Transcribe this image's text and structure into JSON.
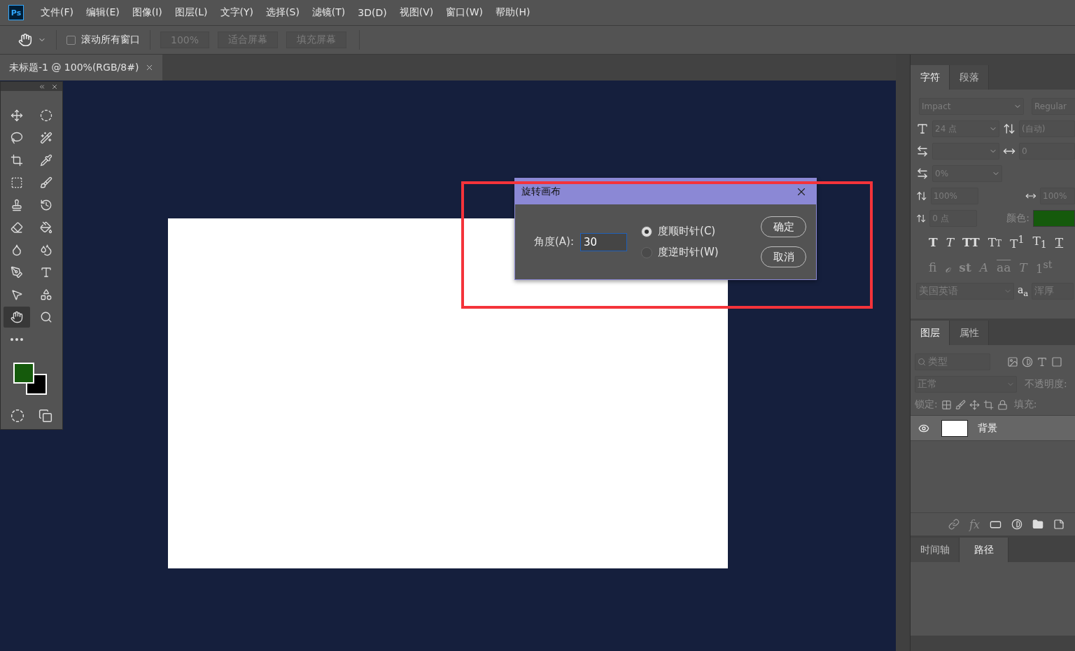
{
  "app_logo": "Ps",
  "menu": [
    "文件(F)",
    "编辑(E)",
    "图像(I)",
    "图层(L)",
    "文字(Y)",
    "选择(S)",
    "滤镜(T)",
    "3D(D)",
    "视图(V)",
    "窗口(W)",
    "帮助(H)"
  ],
  "options_bar": {
    "scroll_all": {
      "label": "滚动所有窗口",
      "checked": false
    },
    "buttons": [
      "100%",
      "适合屏幕",
      "填充屏幕"
    ]
  },
  "document_tab": {
    "title": "未标题-1 @ 100%(RGB/8#)"
  },
  "toolbox": {
    "tools": [
      {
        "kind": "move",
        "selected": false
      },
      {
        "kind": "marquee",
        "selected": false
      },
      {
        "kind": "lasso",
        "selected": false
      },
      {
        "kind": "wand",
        "selected": false
      },
      {
        "kind": "crop",
        "selected": false
      },
      {
        "kind": "eyedropper",
        "selected": false
      },
      {
        "kind": "frame",
        "selected": false
      },
      {
        "kind": "brush",
        "selected": false
      },
      {
        "kind": "stamp",
        "selected": false
      },
      {
        "kind": "history",
        "selected": false
      },
      {
        "kind": "eraser",
        "selected": false
      },
      {
        "kind": "bucket",
        "selected": false
      },
      {
        "kind": "smudge",
        "selected": false
      },
      {
        "kind": "dodge",
        "selected": false
      },
      {
        "kind": "pen",
        "selected": false
      },
      {
        "kind": "type",
        "selected": false
      },
      {
        "kind": "select",
        "selected": false
      },
      {
        "kind": "shape",
        "selected": false
      },
      {
        "kind": "hand",
        "selected": true
      },
      {
        "kind": "zoom",
        "selected": false
      },
      {
        "kind": "more",
        "selected": false
      }
    ],
    "swatches": [
      {
        "kind": "foreground",
        "color": "#155a0c"
      },
      {
        "kind": "background",
        "color": "#000000"
      }
    ]
  },
  "dialog": {
    "title": "旋转画布",
    "angle_label": "角度(A):",
    "angle_value": "30",
    "options": [
      {
        "label": "度顺时针(C)",
        "selected": true
      },
      {
        "label": "度逆时针(W)",
        "selected": false
      }
    ],
    "buttons": [
      "确定",
      "取消"
    ]
  },
  "character_panel": {
    "tabs": [
      {
        "label": "字符",
        "selected": true
      },
      {
        "label": "段落",
        "selected": false
      }
    ],
    "font_family": "Impact",
    "font_style": "Regular",
    "size": "24 点",
    "leading": "(自动)",
    "tracking": "0",
    "tsume": "0%",
    "vertical_scale": "100%",
    "horizontal_scale": "100%",
    "baseline_shift": "0 点",
    "color_label": "颜色:",
    "color": "#155a0c",
    "style_buttons": [
      {
        "text": "T",
        "kind": "bold"
      },
      {
        "text": "T",
        "kind": "italic"
      },
      {
        "text": "TT",
        "kind": "caps"
      },
      {
        "text": "Tт",
        "kind": "smallcaps"
      },
      {
        "text": "T$^{1}$",
        "kind": "plain"
      },
      {
        "text": "T$_{1}$",
        "kind": "plain"
      },
      {
        "text": "T",
        "kind": "underline"
      }
    ],
    "opentype_buttons": [
      {
        "text": "fi",
        "kind": "plain"
      },
      {
        "text": "ℴ",
        "kind": "italic"
      },
      {
        "text": "st",
        "kind": "bold"
      },
      {
        "text": "A",
        "kind": "italic"
      },
      {
        "text": "aa",
        "kind": "overline"
      },
      {
        "text": "T",
        "kind": "italic"
      },
      {
        "text": "1$^{st}$",
        "kind": "plain"
      }
    ],
    "language": "美国英语",
    "antialias_label": "a$_{a}$",
    "antialias": "浑厚"
  },
  "layers_panel": {
    "tabs": [
      {
        "label": "图层",
        "selected": true
      },
      {
        "label": "属性",
        "selected": false
      }
    ],
    "filter": "类型",
    "blend_mode": "正常",
    "opacity_label": "不透明度:",
    "lock_label": "锁定:",
    "fill_label": "填充:",
    "layers": [
      {
        "name": "背景",
        "visible": true,
        "selected": true
      }
    ],
    "footer_fx": "fx"
  },
  "bottom_panel": {
    "tabs": [
      {
        "label": "时间轴",
        "selected": false
      },
      {
        "label": "路径",
        "selected": true
      }
    ]
  }
}
